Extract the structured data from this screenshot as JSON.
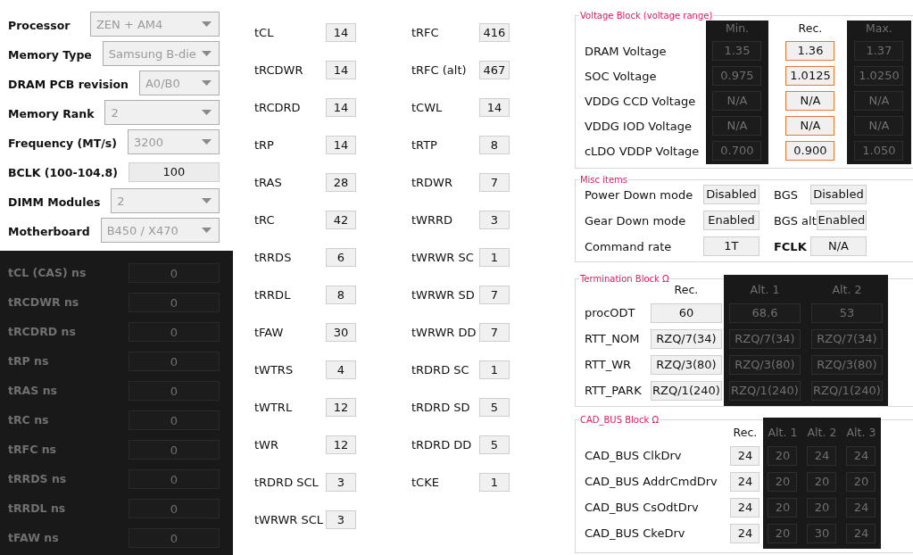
{
  "setup": [
    {
      "label": "Processor",
      "kind": "dropdown",
      "value": "ZEN + AM4"
    },
    {
      "label": "Memory Type",
      "kind": "dropdown",
      "value": "Samsung B-die"
    },
    {
      "label": "DRAM PCB revision",
      "kind": "dropdown",
      "value": "A0/B0"
    },
    {
      "label": "Memory Rank",
      "kind": "dropdown",
      "value": "2"
    },
    {
      "label": "Frequency (MT/s)",
      "kind": "dropdown",
      "value": "3200"
    },
    {
      "label": "BCLK (100-104.8)",
      "kind": "input",
      "value": "100"
    },
    {
      "label": "DIMM Modules",
      "kind": "dropdown",
      "value": "2"
    },
    {
      "label": "Motherboard",
      "kind": "dropdown",
      "value": "B450 / X470"
    }
  ],
  "ns_timings": {
    "shaded": true,
    "rows": [
      {
        "label": "tCL (CAS) ns",
        "value": "0"
      },
      {
        "label": "tRCDWR ns",
        "value": "0"
      },
      {
        "label": "tRCDRD ns",
        "value": "0"
      },
      {
        "label": "tRP ns",
        "value": "0"
      },
      {
        "label": "tRAS ns",
        "value": "0"
      },
      {
        "label": "tRC ns",
        "value": "0"
      },
      {
        "label": "tRFC ns",
        "value": "0"
      },
      {
        "label": "tRRDS ns",
        "value": "0"
      },
      {
        "label": "tRRDL ns",
        "value": "0"
      },
      {
        "label": "tFAW ns",
        "value": "0"
      }
    ]
  },
  "timings_left": [
    {
      "label": "tCL",
      "value": "14"
    },
    {
      "label": "tRCDWR",
      "value": "14"
    },
    {
      "label": "tRCDRD",
      "value": "14"
    },
    {
      "label": "tRP",
      "value": "14"
    },
    {
      "label": "tRAS",
      "value": "28"
    },
    {
      "label": "tRC",
      "value": "42"
    },
    {
      "label": "tRRDS",
      "value": "6"
    },
    {
      "label": "tRRDL",
      "value": "8"
    },
    {
      "label": "tFAW",
      "value": "30"
    },
    {
      "label": "tWTRS",
      "value": "4"
    },
    {
      "label": "tWTRL",
      "value": "12"
    },
    {
      "label": "tWR",
      "value": "12"
    },
    {
      "label": "tRDRD SCL",
      "value": "3"
    },
    {
      "label": "tWRWR SCL",
      "value": "3"
    }
  ],
  "timings_right": [
    {
      "label": "tRFC",
      "value": "416"
    },
    {
      "label": "tRFC (alt)",
      "value": "467"
    },
    {
      "label": "tCWL",
      "value": "14"
    },
    {
      "label": "tRTP",
      "value": "8"
    },
    {
      "label": "tRDWR",
      "value": "7"
    },
    {
      "label": "tWRRD",
      "value": "3"
    },
    {
      "label": "tWRWR SC",
      "value": "1"
    },
    {
      "label": "tWRWR SD",
      "value": "7"
    },
    {
      "label": "tWRWR DD",
      "value": "7"
    },
    {
      "label": "tRDRD SC",
      "value": "1"
    },
    {
      "label": "tRDRD SD",
      "value": "5"
    },
    {
      "label": "tRDRD DD",
      "value": "5"
    },
    {
      "label": "tCKE",
      "value": "1"
    }
  ],
  "voltage_block": {
    "title": "Voltage Block (voltage range)",
    "labels": [
      "DRAM Voltage",
      "SOC Voltage",
      "VDDG  CCD Voltage",
      "VDDG  IOD Voltage",
      "cLDO VDDP Voltage"
    ],
    "columns": [
      {
        "header": "Min.",
        "shaded": true,
        "highlighted": false,
        "values": [
          "1.35",
          "0.975",
          "N/A",
          "N/A",
          "0.700"
        ]
      },
      {
        "header": "Rec.",
        "shaded": false,
        "highlighted": true,
        "values": [
          "1.36",
          "1.0125",
          "N/A",
          "N/A",
          "0.900"
        ]
      },
      {
        "header": "Max.",
        "shaded": true,
        "highlighted": false,
        "values": [
          "1.37",
          "1.0250",
          "N/A",
          "N/A",
          "1.050"
        ]
      }
    ]
  },
  "misc_items": {
    "title": "Misc items",
    "items": [
      {
        "label": "Power Down mode",
        "value": "Disabled",
        "bold": false
      },
      {
        "label": "BGS",
        "value": "Disabled",
        "bold": false
      },
      {
        "label": "Gear Down mode",
        "value": "Enabled",
        "bold": false
      },
      {
        "label": "BGS alt",
        "value": "Enabled",
        "bold": false
      },
      {
        "label": "Command rate",
        "value": "1T",
        "bold": false
      },
      {
        "label": "FCLK",
        "value": "N/A",
        "bold": true
      }
    ]
  },
  "termination_block": {
    "title": "Termination Block Ω",
    "labels": [
      "procODT",
      "RTT_NOM",
      "RTT_WR",
      "RTT_PARK"
    ],
    "columns": [
      {
        "header": "Rec.",
        "shaded": false,
        "values": [
          "60",
          "RZQ/7(34)",
          "RZQ/3(80)",
          "RZQ/1(240)"
        ]
      },
      {
        "header": "Alt. 1",
        "shaded": true,
        "values": [
          "68.6",
          "RZQ/7(34)",
          "RZQ/3(80)",
          "RZQ/1(240)"
        ]
      },
      {
        "header": "Alt. 2",
        "shaded": true,
        "values": [
          "53",
          "RZQ/7(34)",
          "RZQ/3(80)",
          "RZQ/1(240)"
        ]
      }
    ]
  },
  "cad_bus_block": {
    "title": "CAD_BUS Block Ω",
    "labels": [
      "CAD_BUS ClkDrv",
      "CAD_BUS AddrCmdDrv",
      "CAD_BUS CsOdtDrv",
      "CAD_BUS CkeDrv"
    ],
    "columns": [
      {
        "header": "Rec.",
        "shaded": false,
        "values": [
          "24",
          "24",
          "24",
          "24"
        ]
      },
      {
        "header": "Alt. 1",
        "shaded": true,
        "values": [
          "20",
          "20",
          "20",
          "20"
        ]
      },
      {
        "header": "Alt. 2",
        "shaded": true,
        "values": [
          "24",
          "20",
          "20",
          "30"
        ]
      },
      {
        "header": "Alt. 3",
        "shaded": true,
        "values": [
          "24",
          "20",
          "24",
          "24"
        ]
      }
    ]
  }
}
